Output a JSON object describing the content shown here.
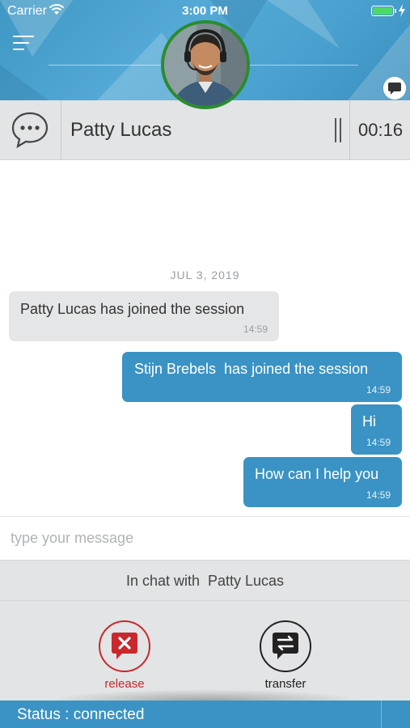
{
  "status_bar": {
    "carrier": "Carrier",
    "time": "3:00 PM",
    "wifi_icon": "wifi-icon",
    "battery_icon": "battery-charging-icon"
  },
  "header": {
    "menu_icon": "menu-icon",
    "avatar": "agent-avatar-photo",
    "chat_icon": "speech-bubble-icon"
  },
  "contact": {
    "icon": "chat-dots-icon",
    "name": "Patty Lucas",
    "pause_icon": "pause-icon",
    "timer": "00:16"
  },
  "conversation": {
    "date": "JUL 3, 2019",
    "messages": [
      {
        "direction": "in",
        "text": "Patty Lucas has joined the session",
        "time": "14:59"
      },
      {
        "direction": "out",
        "text": "Stijn Brebels  has joined the session",
        "time": "14:59"
      },
      {
        "direction": "out",
        "text": "Hi",
        "time": "14:59"
      },
      {
        "direction": "out",
        "text": "How can I help you",
        "time": "14:59"
      }
    ]
  },
  "composer": {
    "placeholder": "type your message",
    "value": ""
  },
  "chat_with": "In chat with  Patty Lucas",
  "actions": {
    "release": {
      "label": "release",
      "icon": "release-x-icon"
    },
    "transfer": {
      "label": "transfer",
      "icon": "transfer-arrows-icon"
    }
  },
  "footer": {
    "status": "Status : connected"
  },
  "colors": {
    "primary_blue": "#3a93c4",
    "header_blue": "#4aa1cf",
    "avatar_ring": "#2b8c2b",
    "release_red": "#c9282d",
    "panel_gray": "#e2e4e5",
    "incoming_bubble": "#e5e6e7"
  }
}
